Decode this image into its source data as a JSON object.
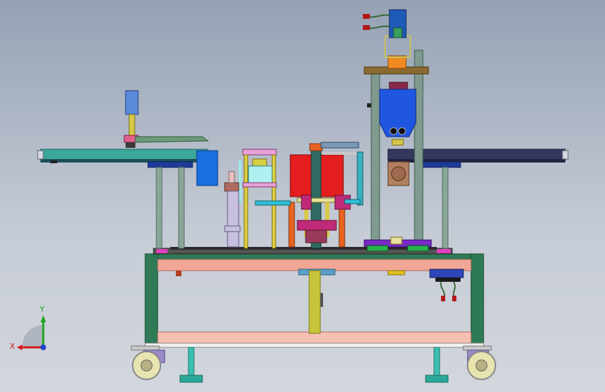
{
  "view_triad": {
    "x_label": "X",
    "y_label": "Y",
    "x_color": "#d41c1c",
    "y_color": "#1fa51f",
    "z_color": "#2040d0"
  },
  "colors": {
    "background_top": "#95a1b4",
    "background_bottom": "#d2d6dd",
    "frame_green": "#2f7a56",
    "table_salmon": "#f2a796",
    "conveyor_teal": "#3aa79a",
    "conveyor_navy": "#34385e",
    "hopper_blue": "#1f57e0",
    "press_red": "#e41e1e",
    "accent_magenta": "#c02a78",
    "column_gray": "#7f9a8e"
  }
}
